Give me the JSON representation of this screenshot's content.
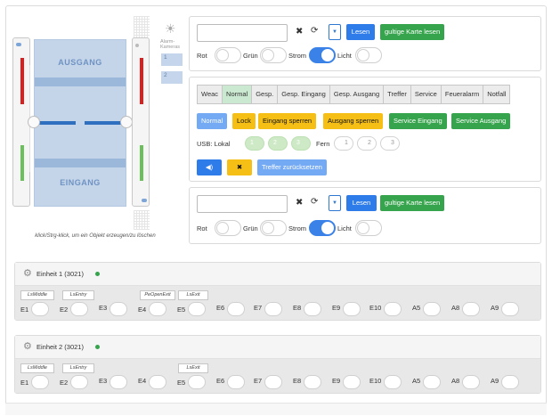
{
  "gate": {
    "label_top": "AUSGANG",
    "label_bottom": "EINGANG",
    "caption": "klick/Strg-klick, um ein Objekt erzeugen/zu löschen",
    "alarm_label": "Alarm-Kameras",
    "alarm_boxes": [
      "1",
      "2"
    ]
  },
  "panel1": {
    "input_value": "",
    "clear_icon": "close-icon",
    "refresh_icon": "refresh-icon",
    "dropdown_icon": "chevron-down-icon",
    "read_btn": "Lesen",
    "valid_card_btn": "gultige Karte lesen",
    "toggles": [
      {
        "label": "Rot",
        "on": false
      },
      {
        "label": "Grün",
        "on": false
      },
      {
        "label": "Strom",
        "on": true
      },
      {
        "label": "Licht",
        "on": false
      }
    ]
  },
  "panel2": {
    "tabs": [
      "Weac",
      "Normal",
      "Gesp.",
      "Gesp. Eingang",
      "Gesp. Ausgang",
      "Treffer",
      "Service",
      "Feueralarm",
      "Notfall"
    ],
    "active_tab": "Normal",
    "mode_buttons": [
      {
        "label": "Normal",
        "color": "#74aaf3"
      },
      {
        "label": "Lock",
        "color": "#f6bf16"
      },
      {
        "label": "Eingang sperren",
        "color": "#f6bf16"
      },
      {
        "label": "Ausgang sperren",
        "color": "#f6bf16"
      },
      {
        "label": "Service Eingang",
        "color": "#36a44c"
      },
      {
        "label": "Service Ausgang",
        "color": "#36a44c"
      }
    ],
    "usb_label": "USB: Lokal",
    "usb_local": [
      "1",
      "2",
      "3"
    ],
    "fern_label": "Fern",
    "usb_remote": [
      "1",
      "2",
      "3"
    ],
    "sound_icon": "speaker-icon",
    "mute_icon": "close-icon",
    "reset_hits_btn": "Treffer zurücksetzen"
  },
  "panel3": {
    "input_value": "",
    "read_btn": "Lesen",
    "valid_card_btn": "gultige Karte lesen",
    "toggles": [
      {
        "label": "Rot",
        "on": false
      },
      {
        "label": "Grün",
        "on": false
      },
      {
        "label": "Strom",
        "on": true
      },
      {
        "label": "Licht",
        "on": false
      }
    ]
  },
  "units": [
    {
      "title": "Einheit 1 (3021)",
      "status_color": "#36a44c",
      "tags": [
        "LsMiddle",
        "LsEntry",
        "PeOpenExit",
        "LsExit"
      ],
      "pins": [
        "E1",
        "E2",
        "E3",
        "E4",
        "E5",
        "E6",
        "E7",
        "E8",
        "E9",
        "E10",
        "A5",
        "A8",
        "A9"
      ]
    },
    {
      "title": "Einheit 2 (3021)",
      "status_color": "#36a44c",
      "tags": [
        "LsMiddle",
        "LsEntry",
        "LsExit"
      ],
      "pins": [
        "E1",
        "E2",
        "E3",
        "E4",
        "E5",
        "E6",
        "E7",
        "E8",
        "E9",
        "E10",
        "A5",
        "A8",
        "A9"
      ]
    }
  ]
}
